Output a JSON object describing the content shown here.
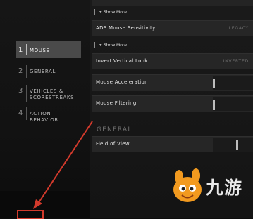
{
  "nav": {
    "items": [
      {
        "number": "1",
        "label": "MOUSE",
        "active": true
      },
      {
        "number": "2",
        "label": "GENERAL",
        "active": false
      },
      {
        "number": "3",
        "label": "VEHICLES &\nSCORESTREAKS",
        "active": false
      },
      {
        "number": "4",
        "label": "ACTION BEHAVIOR",
        "active": false
      }
    ]
  },
  "settings": {
    "show_more_label": "+ Show More",
    "ads_sensitivity": {
      "label": "ADS Mouse Sensitivity",
      "value": "LEGACY"
    },
    "invert_look": {
      "label": "Invert Vertical Look",
      "value": "INVERTED"
    },
    "mouse_acceleration": {
      "label": "Mouse Acceleration"
    },
    "mouse_filtering": {
      "label": "Mouse Filtering"
    },
    "section_general": "GENERAL",
    "field_of_view": {
      "label": "Field of View"
    }
  },
  "watermark": {
    "text": "九游",
    "icon": "mascot-icon"
  },
  "annotation": {
    "color": "#d23a2c"
  }
}
